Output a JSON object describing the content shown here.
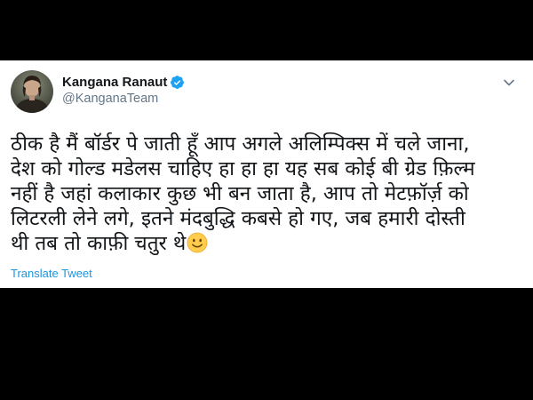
{
  "tweet": {
    "display_name": "Kangana Ranaut",
    "handle": "@KanganaTeam",
    "verified": true,
    "lines": [
      "ठीक है मैं बॉर्डर पे जाती हूँ आप अगले अलिम्पिक्स में चले जाना,",
      "देश को गोल्ड मडेलस चाहिए हा हा हा यह सब कोई बी ग्रेड फ़िल्म",
      "नहीं है जहां कलाकार कुछ भी बन जाता है, आप तो मेटफ़ॉर्ज़ को",
      "लिटरली लेने लगे, इतने मंदबुद्धि कबसे हो गए, जब हमारी दोस्ती",
      "थी तब तो काफ़ी चतुर थे"
    ],
    "emoji": "slightly-smiling-face",
    "translate_label": "Translate Tweet"
  },
  "colors": {
    "background": "#000000",
    "card": "#ffffff",
    "text": "#14171a",
    "secondary_text": "#657786",
    "link": "#1b95e0",
    "verified_badge": "#1da1f2"
  },
  "icons": {
    "verified": "verified-badge-icon",
    "menu": "chevron-down-icon",
    "emoji": "smiley-emoji-icon"
  }
}
